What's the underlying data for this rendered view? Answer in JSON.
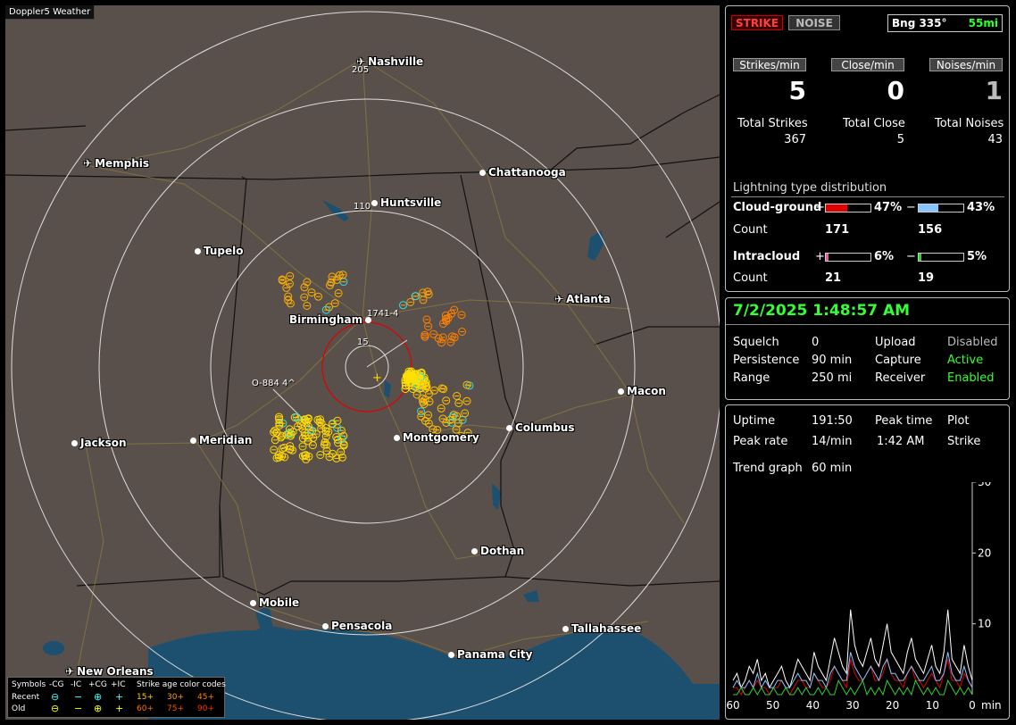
{
  "app": {
    "title": "Doppler5 Weather"
  },
  "map": {
    "cities": [
      {
        "name": "Nashville",
        "icon": "airport-icon"
      },
      {
        "name": "Memphis",
        "icon": "airport-icon"
      },
      {
        "name": "Chattanooga",
        "icon": "city-dot-icon"
      },
      {
        "name": "Huntsville",
        "icon": "city-dot-icon"
      },
      {
        "name": "Tupelo",
        "icon": "city-dot-icon"
      },
      {
        "name": "Atlanta",
        "icon": "airport-icon"
      },
      {
        "name": "Birmingham",
        "icon": "city-dot-icon"
      },
      {
        "name": "Macon",
        "icon": "city-dot-icon"
      },
      {
        "name": "Jackson",
        "icon": "city-dot-icon"
      },
      {
        "name": "Meridian",
        "icon": "city-dot-icon"
      },
      {
        "name": "Montgomery",
        "icon": "city-dot-icon"
      },
      {
        "name": "Columbus",
        "icon": "city-dot-icon"
      },
      {
        "name": "Dothan",
        "icon": "city-dot-icon"
      },
      {
        "name": "Mobile",
        "icon": "city-dot-icon"
      },
      {
        "name": "Pensacola",
        "icon": "city-dot-icon"
      },
      {
        "name": "Tallahassee",
        "icon": "city-dot-icon"
      },
      {
        "name": "Panama City",
        "icon": "city-dot-icon"
      },
      {
        "name": "New Orleans",
        "icon": "airport-icon"
      }
    ],
    "ring_labels": [
      "205",
      "110",
      "15"
    ],
    "cluster_labels": [
      "1741-4",
      "O-884 4^"
    ]
  },
  "legend": {
    "symbols_label": "Symbols",
    "col_labels": [
      "-CG",
      "-IC",
      "+CG",
      "+IC"
    ],
    "age_label": "Strike age color codes",
    "recent_label": "Recent",
    "old_label": "Old",
    "recent_ages": [
      "15+",
      "30+",
      "45+"
    ],
    "old_ages": [
      "60+",
      "75+",
      "90+"
    ]
  },
  "status": {
    "strike_label": "STRIKE",
    "noise_label": "NOISE",
    "bearing_label": "Bng 335°",
    "distance_label": "55mi"
  },
  "rates": {
    "strikes_label": "Strikes/min",
    "strikes_value": "5",
    "close_label": "Close/min",
    "close_value": "0",
    "noises_label": "Noises/min",
    "noises_value": "1"
  },
  "totals": {
    "strikes_label": "Total Strikes",
    "strikes_value": "367",
    "close_label": "Total Close",
    "close_value": "5",
    "noises_label": "Total Noises",
    "noises_value": "43"
  },
  "distribution": {
    "title": "Lightning type distribution",
    "cg_label": "Cloud-ground",
    "cg_pos_pct": "47%",
    "cg_neg_pct": "43%",
    "cg_pos_fill": 0.47,
    "cg_neg_fill": 0.43,
    "count_label": "Count",
    "cg_pos_count": "171",
    "cg_neg_count": "156",
    "ic_label": "Intracloud",
    "ic_pos_pct": "6%",
    "ic_neg_pct": "5%",
    "ic_pos_fill": 0.06,
    "ic_neg_fill": 0.05,
    "ic_pos_count": "21",
    "ic_neg_count": "19",
    "plus": "+",
    "minus": "−",
    "colors": {
      "cg_pos": "#e00000",
      "cg_neg": "#88c4ff",
      "ic_pos": "#e060a0",
      "ic_neg": "#30d030"
    }
  },
  "datetime": "7/2/2025 1:48:57 AM",
  "settings": {
    "squelch_label": "Squelch",
    "squelch_value": "0",
    "persistence_label": "Persistence",
    "persistence_value": "90 min",
    "range_label": "Range",
    "range_value": "250 mi",
    "upload_label": "Upload",
    "upload_value": "Disabled",
    "capture_label": "Capture",
    "capture_value": "Active",
    "receiver_label": "Receiver",
    "receiver_value": "Enabled"
  },
  "stats": {
    "uptime_label": "Uptime",
    "uptime_value": "191:50",
    "peak_time_label": "Peak time",
    "peak_time_value": "1:42 AM",
    "plot_label": "Plot",
    "plot_value": "Strike",
    "peak_rate_label": "Peak rate",
    "peak_rate_value": "14/min",
    "trend_label": "Trend graph",
    "trend_value": "60 min"
  },
  "chart_data": {
    "type": "line",
    "x_ticks": [
      "60",
      "50",
      "40",
      "30",
      "20",
      "10",
      "0"
    ],
    "x_unit": "min",
    "y_ticks": [
      "30",
      "20",
      "10"
    ],
    "ylim": [
      0,
      30
    ],
    "xlim": [
      60,
      0
    ],
    "series": [
      {
        "color": "#ffffff",
        "values": [
          2,
          3,
          1,
          2,
          4,
          3,
          5,
          2,
          3,
          1,
          2,
          3,
          4,
          2,
          1,
          3,
          5,
          4,
          3,
          2,
          6,
          4,
          3,
          2,
          5,
          8,
          6,
          4,
          3,
          12,
          7,
          5,
          4,
          6,
          8,
          5,
          4,
          7,
          10,
          6,
          5,
          4,
          3,
          6,
          8,
          5,
          4,
          3,
          5,
          7,
          4,
          3,
          6,
          12,
          5,
          4,
          3,
          7,
          4,
          2
        ]
      },
      {
        "color": "#e00000",
        "values": [
          1,
          1,
          0,
          1,
          2,
          1,
          2,
          1,
          1,
          0,
          1,
          1,
          2,
          1,
          0,
          1,
          2,
          2,
          1,
          1,
          3,
          2,
          1,
          1,
          2,
          4,
          3,
          2,
          1,
          5,
          3,
          2,
          2,
          3,
          4,
          2,
          2,
          3,
          5,
          3,
          2,
          2,
          1,
          3,
          4,
          2,
          2,
          1,
          2,
          3,
          2,
          1,
          3,
          5,
          2,
          2,
          1,
          3,
          2,
          1
        ]
      },
      {
        "color": "#88c4ff",
        "values": [
          1,
          2,
          1,
          1,
          2,
          1,
          3,
          1,
          2,
          1,
          1,
          2,
          2,
          1,
          1,
          2,
          3,
          2,
          2,
          1,
          3,
          2,
          2,
          1,
          3,
          4,
          3,
          2,
          2,
          6,
          4,
          3,
          2,
          3,
          4,
          3,
          2,
          4,
          5,
          3,
          3,
          2,
          2,
          3,
          4,
          3,
          2,
          2,
          3,
          4,
          2,
          2,
          3,
          6,
          3,
          2,
          2,
          4,
          2,
          1
        ]
      },
      {
        "color": "#30d030",
        "values": [
          0,
          0,
          1,
          0,
          0,
          1,
          0,
          1,
          0,
          0,
          1,
          0,
          0,
          1,
          0,
          0,
          1,
          0,
          1,
          0,
          0,
          1,
          0,
          1,
          0,
          0,
          2,
          1,
          0,
          1,
          0,
          1,
          2,
          0,
          1,
          0,
          1,
          0,
          2,
          1,
          0,
          1,
          0,
          1,
          0,
          2,
          1,
          0,
          1,
          0,
          1,
          0,
          0,
          2,
          1,
          0,
          1,
          0,
          1,
          0
        ]
      }
    ]
  }
}
